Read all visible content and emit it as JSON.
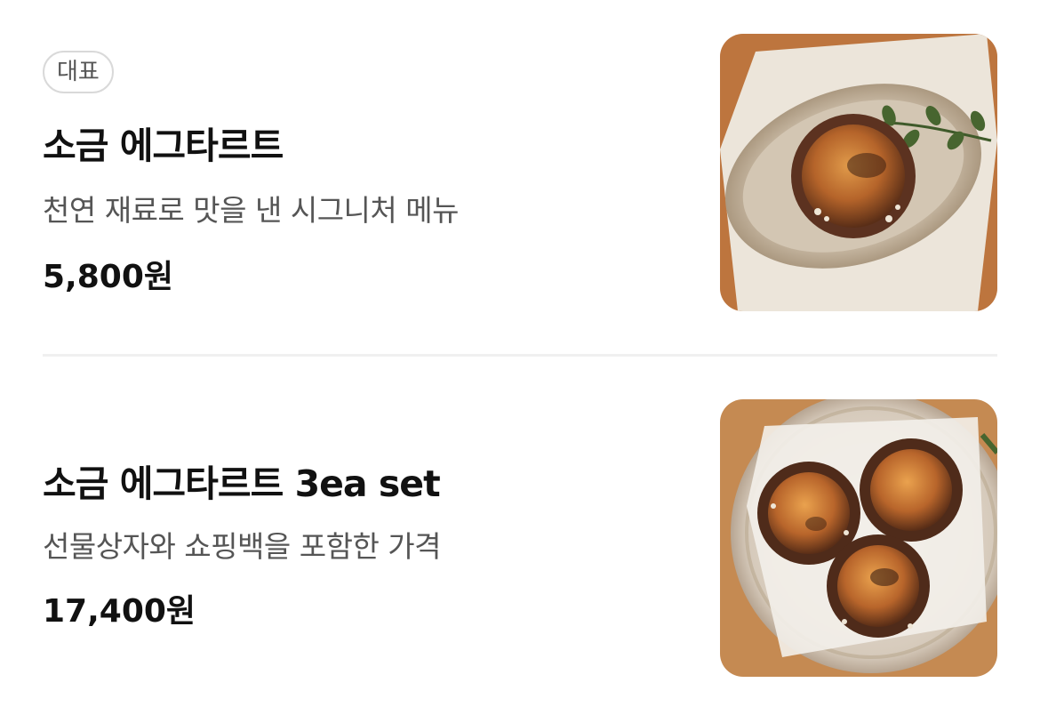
{
  "items": [
    {
      "badge": "대표",
      "name": "소금 에그타르트",
      "description": "천연 재료로 맛을 낸 시그니처 메뉴",
      "price": "5,800원",
      "image": "single-egg-tart-on-plate"
    },
    {
      "name": "소금 에그타르트 3ea set",
      "description": "선물상자와 쇼핑백을 포함한 가격",
      "price": "17,400원",
      "image": "three-egg-tarts-on-plate"
    }
  ],
  "colors": {
    "text_primary": "#111111",
    "text_secondary": "#555555",
    "badge_border": "#d9d9d9",
    "divider": "#f0f0f0"
  }
}
